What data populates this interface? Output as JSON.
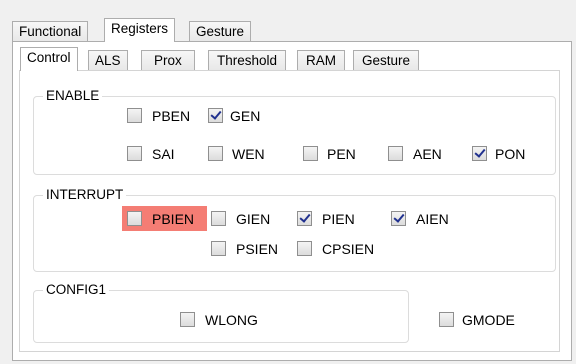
{
  "outer_tabs": [
    {
      "label": "Functional",
      "active": false
    },
    {
      "label": "Registers",
      "active": true
    },
    {
      "label": "Gesture",
      "active": false
    }
  ],
  "inner_tabs": [
    {
      "label": "Control",
      "active": true
    },
    {
      "label": "ALS",
      "active": false
    },
    {
      "label": "Prox",
      "active": false
    },
    {
      "label": "Threshold",
      "active": false
    },
    {
      "label": "RAM",
      "active": false
    },
    {
      "label": "Gesture",
      "active": false
    }
  ],
  "groups": {
    "enable": {
      "title": "ENABLE",
      "checkboxes": [
        {
          "label": "PBEN",
          "checked": false
        },
        {
          "label": "GEN",
          "checked": true
        },
        {
          "label": "SAI",
          "checked": false
        },
        {
          "label": "WEN",
          "checked": false
        },
        {
          "label": "PEN",
          "checked": false
        },
        {
          "label": "AEN",
          "checked": false
        },
        {
          "label": "PON",
          "checked": true
        }
      ]
    },
    "interrupt": {
      "title": "INTERRUPT",
      "checkboxes": [
        {
          "label": "PBIEN",
          "checked": false,
          "highlighted": true
        },
        {
          "label": "GIEN",
          "checked": false
        },
        {
          "label": "PIEN",
          "checked": true
        },
        {
          "label": "AIEN",
          "checked": true
        },
        {
          "label": "PSIEN",
          "checked": false
        },
        {
          "label": "CPSIEN",
          "checked": false
        }
      ]
    },
    "config1": {
      "title": "CONFIG1",
      "checkboxes": [
        {
          "label": "WLONG",
          "checked": false
        }
      ]
    }
  },
  "standalone": {
    "gmode": {
      "label": "GMODE",
      "checked": false
    }
  },
  "colors": {
    "highlight": "#f47d74",
    "tab_border": "#adadad",
    "checkmark": "#21318f"
  }
}
